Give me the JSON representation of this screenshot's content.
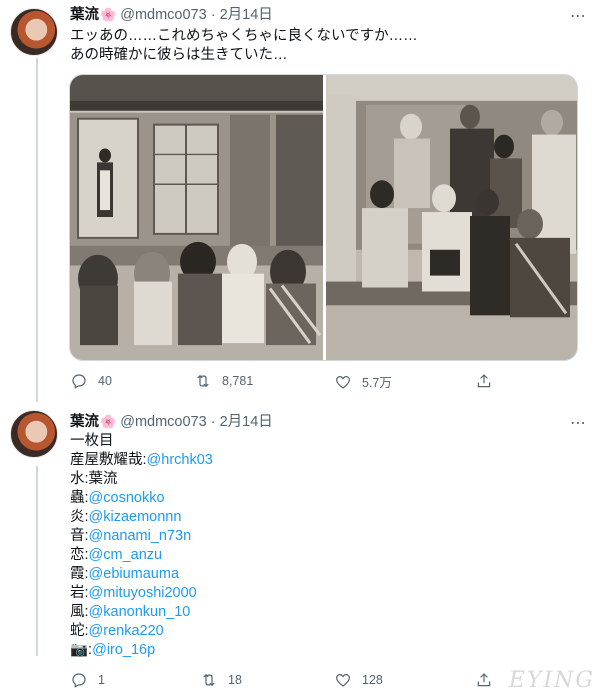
{
  "tweets": [
    {
      "display_name": "葉流",
      "name_emoji": "🌸",
      "handle": "@mdmco073",
      "separator": "·",
      "date": "2月14日",
      "text_lines": [
        "エッあの……これめちゃくちゃに良くないですか……",
        "あの時確かに彼らは生きていた…"
      ],
      "replies": "40",
      "retweets": "8,781",
      "likes": "5.7万"
    },
    {
      "display_name": "葉流",
      "name_emoji": "🌸",
      "handle": "@mdmco073",
      "separator": "·",
      "date": "2月14日",
      "credits_title": "一枚目",
      "credits": [
        {
          "label": "産屋敷耀哉:",
          "mention": "@hrchk03"
        },
        {
          "label": "水:葉流",
          "mention": ""
        },
        {
          "label": "蟲:",
          "mention": "@cosnokko"
        },
        {
          "label": "炎:",
          "mention": "@kizaemonnn"
        },
        {
          "label": "音:",
          "mention": "@nanami_n73n"
        },
        {
          "label": "恋:",
          "mention": "@cm_anzu"
        },
        {
          "label": "霞:",
          "mention": "@ebiumauma"
        },
        {
          "label": "岩:",
          "mention": "@mituyoshi2000"
        },
        {
          "label": "風:",
          "mention": "@kanonkun_10"
        },
        {
          "label": "蛇:",
          "mention": "@renka220"
        },
        {
          "label": "📷:",
          "mention": "@iro_16p"
        }
      ],
      "replies": "1",
      "retweets": "18",
      "likes": "128"
    }
  ],
  "icons": {
    "more": "more-icon",
    "reply": "reply-icon",
    "retweet": "retweet-icon",
    "like": "heart-icon",
    "share": "share-icon"
  },
  "watermark": "EYING"
}
